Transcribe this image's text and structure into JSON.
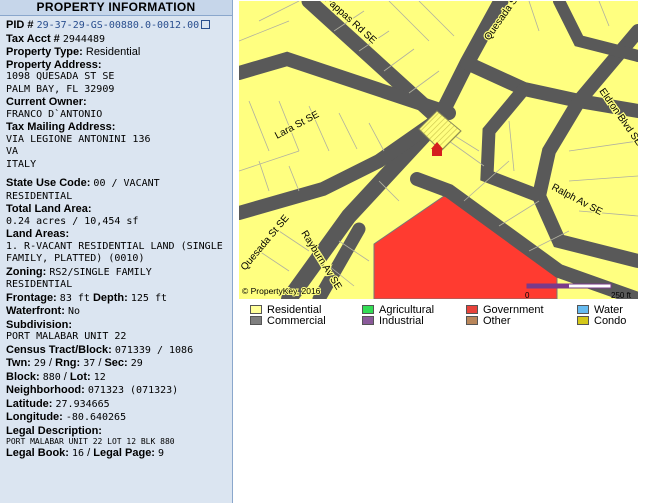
{
  "panel": {
    "title": "PROPERTY INFORMATION",
    "pid_label": "PID #",
    "pid_value": "29-37-29-GS-00880.0-0012.00",
    "tax_acct_label": "Tax Acct #",
    "tax_acct_value": "2944489",
    "property_type_label": "Property Type:",
    "property_type_value": "Residential",
    "address_label": "Property Address:",
    "address_line1": "1098 QUESADA ST SE",
    "address_line2": "PALM BAY, FL 32909",
    "owner_label": "Current Owner:",
    "owner_value": "FRANCO D`ANTONIO",
    "mailing_label": "Tax Mailing Address:",
    "mailing_line1": "VIA LEGIONE ANTONINI 136",
    "mailing_line2": "VA",
    "mailing_line3": "ITALY",
    "state_use_label": "State Use Code:",
    "state_use_value_1": "00 / VACANT",
    "state_use_value_2": "RESIDENTIAL",
    "land_area_label": "Total Land Area:",
    "land_area_value": "0.24 acres / 10,454 sf",
    "land_areas_label": "Land Areas:",
    "land_areas_line1": "1. R-VACANT RESIDENTIAL LAND (SINGLE",
    "land_areas_line2": "FAMILY, PLATTED) (0010)",
    "zoning_label": "Zoning:",
    "zoning_value_1": "RS2/SINGLE FAMILY",
    "zoning_value_2": "RESIDENTIAL",
    "frontage_label": "Frontage:",
    "frontage_value": "83 ft",
    "depth_label": "Depth:",
    "depth_value": "125 ft",
    "waterfront_label": "Waterfront:",
    "waterfront_value": "No",
    "subdivision_label": "Subdivision:",
    "subdivision_value": "PORT MALABAR UNIT 22",
    "census_label": "Census Tract/Block:",
    "census_value": "071339 / 1086",
    "twn_label": "Twn:",
    "twn_value": "29",
    "rng_label": "Rng:",
    "rng_value": "37",
    "sec_label": "Sec:",
    "sec_value": "29",
    "block_label": "Block:",
    "block_value": "880",
    "lot_label": "Lot:",
    "lot_value": "12",
    "neighborhood_label": "Neighborhood:",
    "neighborhood_value": "071323 (071323)",
    "latitude_label": "Latitude:",
    "latitude_value": "27.934665",
    "longitude_label": "Longitude:",
    "longitude_value": "-80.640265",
    "legal_desc_label": "Legal Description:",
    "legal_desc_value": "PORT MALABAR UNIT 22 LOT 12 BLK 880",
    "legal_book_label": "Legal Book:",
    "legal_book_value": "16",
    "legal_page_label": "Legal Page:",
    "legal_page_value": "9"
  },
  "map": {
    "streets": [
      "Pappas Rd SE",
      "Quesada St SE",
      "Lara St SE",
      "Eldron Blvd SE",
      "Ralph Av SE",
      "Rayburn Av SE",
      "Quesada St SE"
    ],
    "copyright": "© PropertyKey, 2016",
    "scale_start": "0",
    "scale_end": "250 ft",
    "colors": {
      "residential": "#ffff80",
      "government": "#ff3b30",
      "road": "#595959"
    }
  },
  "legend": [
    {
      "label": "Residential",
      "color": "#ffff99"
    },
    {
      "label": "Agricultural",
      "color": "#33dd55"
    },
    {
      "label": "Government",
      "color": "#e8423a"
    },
    {
      "label": "Water",
      "color": "#66bbf0"
    },
    {
      "label": "Commercial",
      "color": "#7f7f7f"
    },
    {
      "label": "Industrial",
      "color": "#8a5a9a"
    },
    {
      "label": "Other",
      "color": "#b9865a"
    },
    {
      "label": "Condo",
      "color": "#d4c81a"
    }
  ]
}
